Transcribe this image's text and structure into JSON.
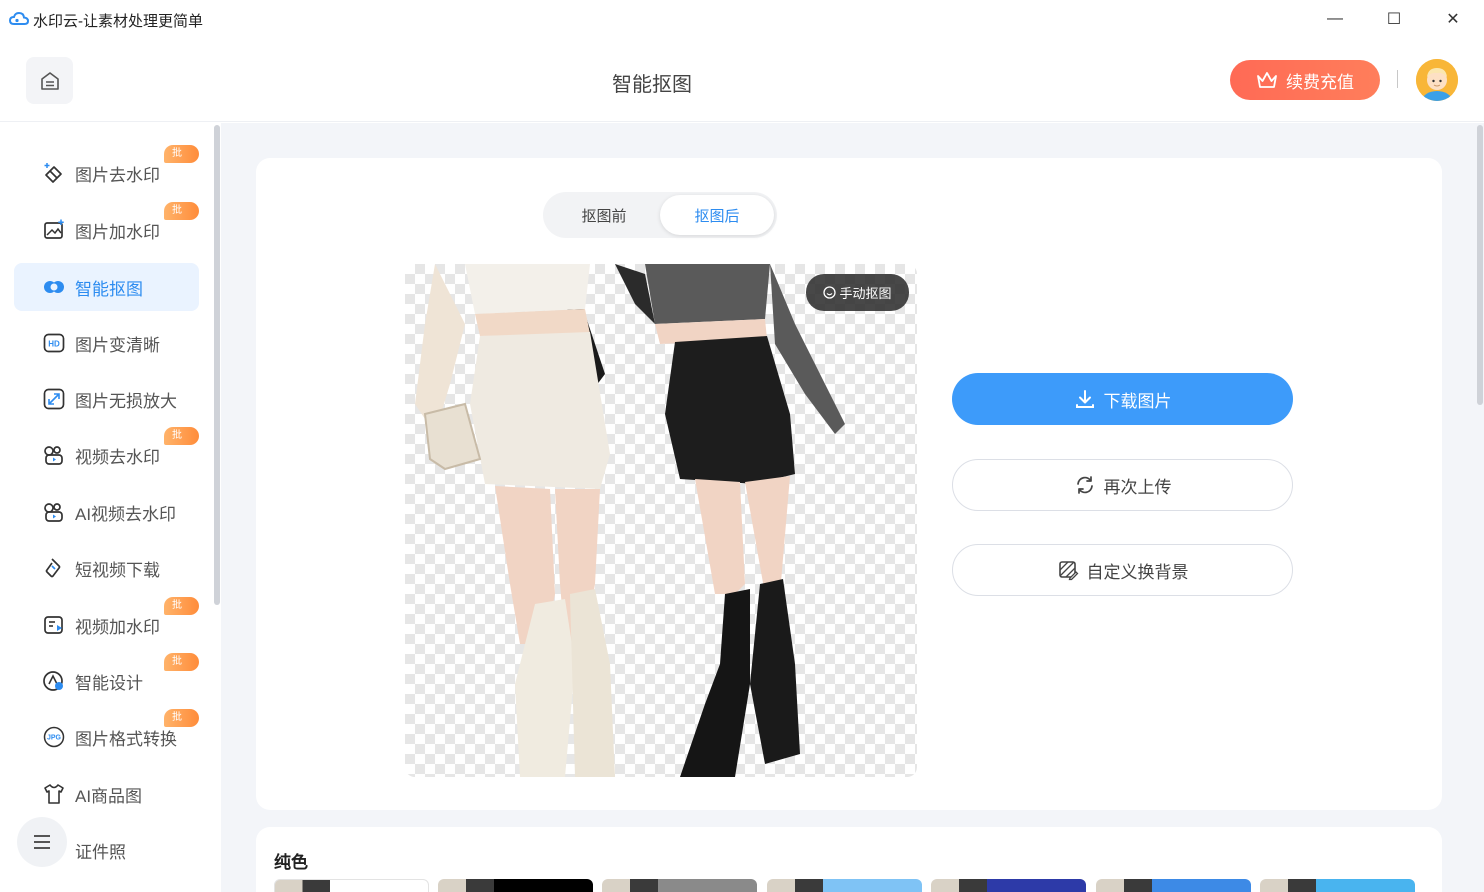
{
  "window": {
    "title": "水印云-让素材处理更简单",
    "minimize": "—",
    "maximize": "☐",
    "close": "✕"
  },
  "header": {
    "page_title": "智能抠图",
    "recharge_label": "续费充值"
  },
  "sidebar": {
    "items": [
      {
        "label": "图片去水印",
        "badge": "批量",
        "icon": "eraser-icon"
      },
      {
        "label": "图片加水印",
        "badge": "批量",
        "icon": "image-add-icon"
      },
      {
        "label": "智能抠图",
        "badge": "",
        "icon": "cutout-icon",
        "active": true
      },
      {
        "label": "图片变清晰",
        "badge": "",
        "icon": "hd-icon"
      },
      {
        "label": "图片无损放大",
        "badge": "",
        "icon": "enlarge-icon"
      },
      {
        "label": "视频去水印",
        "badge": "批量",
        "icon": "video-eraser-icon"
      },
      {
        "label": "AI视频去水印",
        "badge": "",
        "icon": "ai-video-icon"
      },
      {
        "label": "短视频下载",
        "badge": "",
        "icon": "link-download-icon"
      },
      {
        "label": "视频加水印",
        "badge": "批量",
        "icon": "video-add-icon"
      },
      {
        "label": "智能设计",
        "badge": "批量",
        "icon": "design-icon"
      },
      {
        "label": "图片格式转换",
        "badge": "批量",
        "icon": "jpg-icon"
      },
      {
        "label": "AI商品图",
        "badge": "",
        "icon": "tshirt-icon"
      },
      {
        "label": "证件照",
        "badge": "",
        "icon": "id-photo-icon"
      }
    ]
  },
  "main": {
    "toggle": {
      "before": "抠图前",
      "after": "抠图后",
      "selected": "after"
    },
    "manual_cutout": "手动抠图",
    "download_label": "下载图片",
    "reupload_label": "再次上传",
    "custom_bg_label": "自定义换背景",
    "solid_color_title": "纯色",
    "swatches": [
      "#ffffff",
      "#000000",
      "#8a8a8a",
      "#7fc3f5",
      "#2d3aa8",
      "#3d8ae6",
      "#49b4ef"
    ]
  },
  "colors": {
    "accent": "#2d8cf0",
    "download_bg": "#3d9bfa",
    "recharge_bg": "#ff6a55",
    "badge_bg": "#ff8c3a"
  }
}
